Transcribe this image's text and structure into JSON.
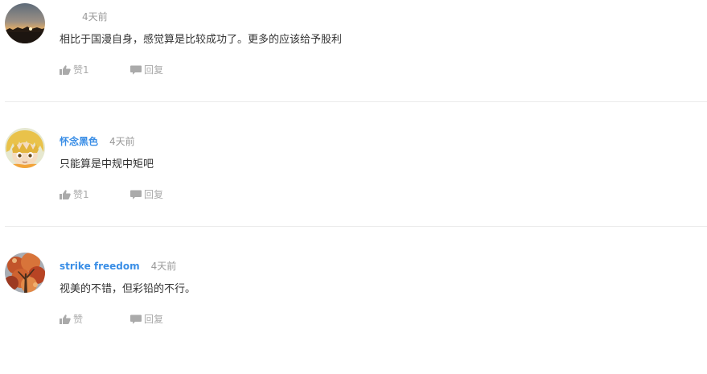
{
  "comments": [
    {
      "username": "",
      "time": "4天前",
      "text": "相比于国漫自身，感觉算是比较成功了。更多的应该给予股利",
      "like_label": "赞1",
      "reply_label": "回复",
      "avatar": "sunset-avatar"
    },
    {
      "username": "怀念黑色",
      "time": "4天前",
      "text": "只能算是中规中矩吧",
      "like_label": "赞1",
      "reply_label": "回复",
      "avatar": "anime-character-avatar"
    },
    {
      "username": "strike freedom",
      "time": "4天前",
      "text": "视美的不错，但彩铅的不行。",
      "like_label": "赞",
      "reply_label": "回复",
      "avatar": "autumn-tree-avatar"
    }
  ],
  "colors": {
    "username": "#3a8ee6",
    "muted": "#999999",
    "text": "#333333",
    "divider": "#ebebeb"
  },
  "icons": {
    "like": "thumbs-up-icon",
    "reply": "speech-bubble-icon"
  }
}
